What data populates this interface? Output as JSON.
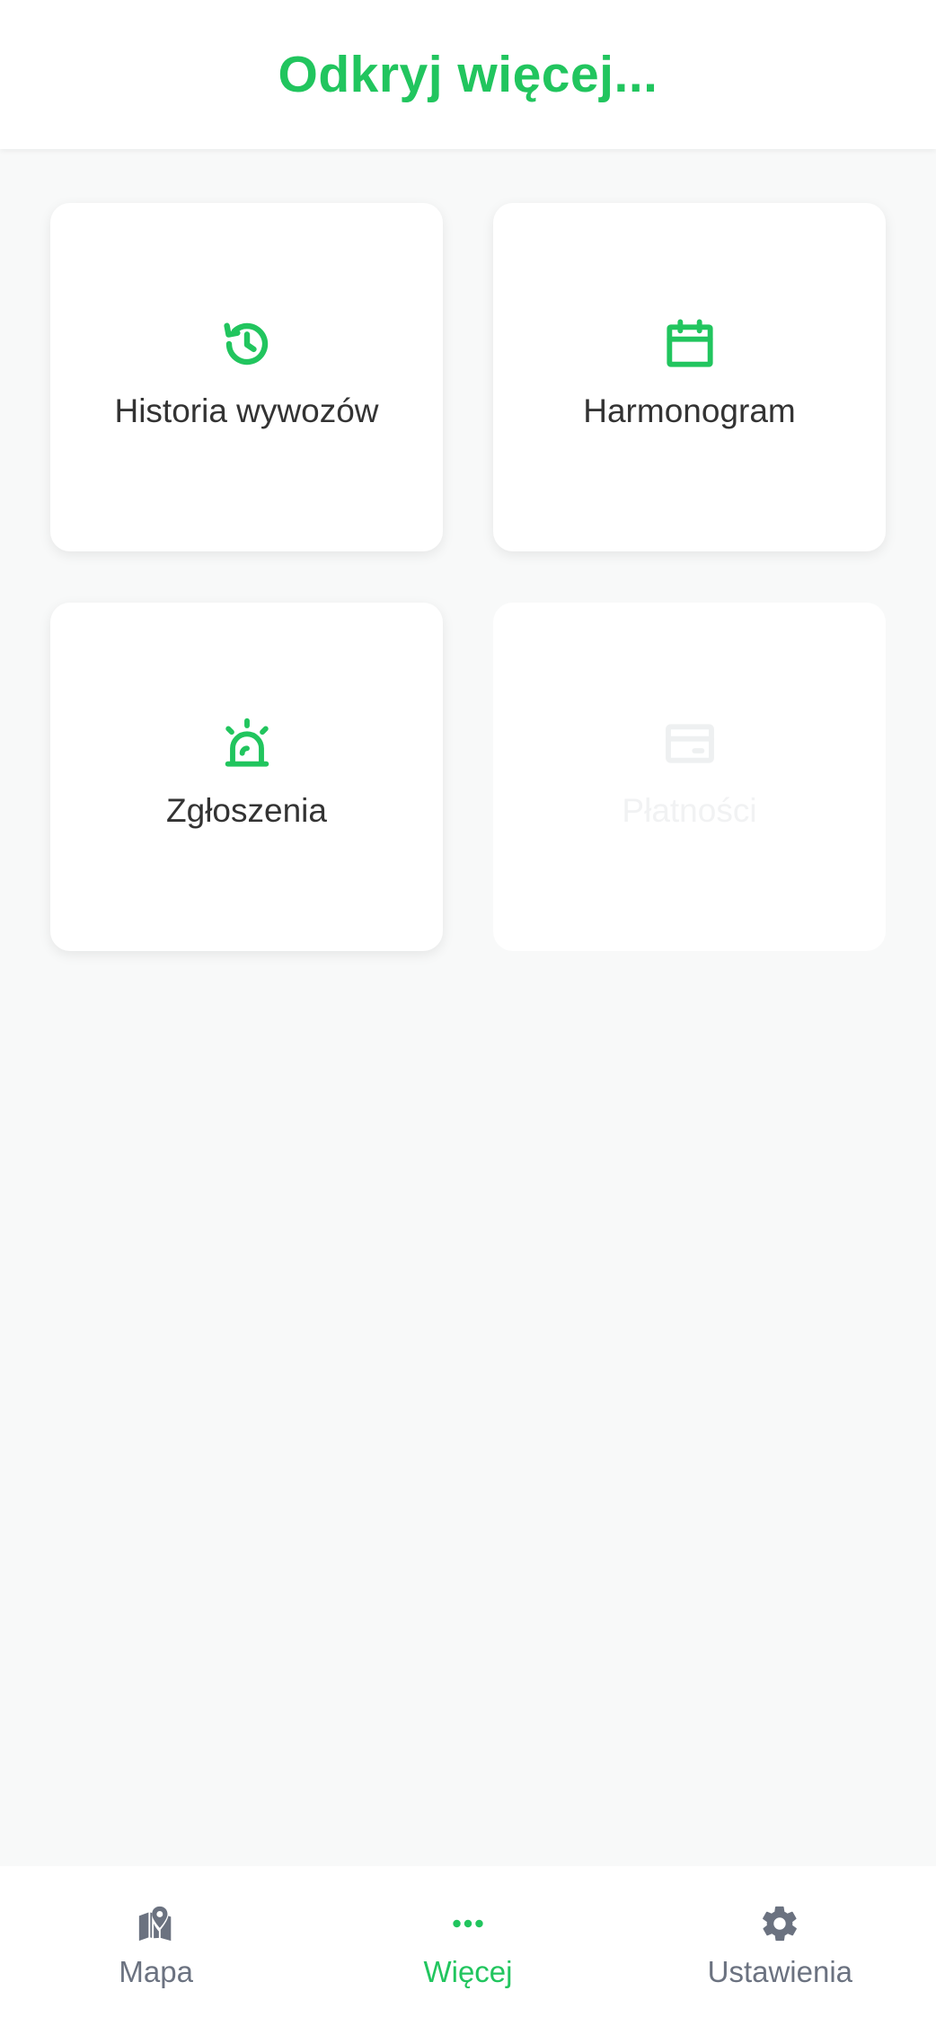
{
  "header": {
    "title": "Odkryj więcej..."
  },
  "tiles": [
    {
      "label": "Historia wywozów",
      "icon": "history-icon",
      "enabled": true
    },
    {
      "label": "Harmonogram",
      "icon": "calendar-icon",
      "enabled": true
    },
    {
      "label": "Zgłoszenia",
      "icon": "alarm-light-icon",
      "enabled": true
    },
    {
      "label": "Płatności",
      "icon": "credit-card-icon",
      "enabled": false
    }
  ],
  "bottom_nav": {
    "items": [
      {
        "label": "Mapa",
        "icon": "map-icon",
        "active": false
      },
      {
        "label": "Więcej",
        "icon": "more-dots-icon",
        "active": true
      },
      {
        "label": "Ustawienia",
        "icon": "gear-icon",
        "active": false
      }
    ]
  },
  "colors": {
    "accent": "#21c55e",
    "text": "#333333",
    "nav_inactive": "#6b7280",
    "background": "#f8f9f9"
  }
}
